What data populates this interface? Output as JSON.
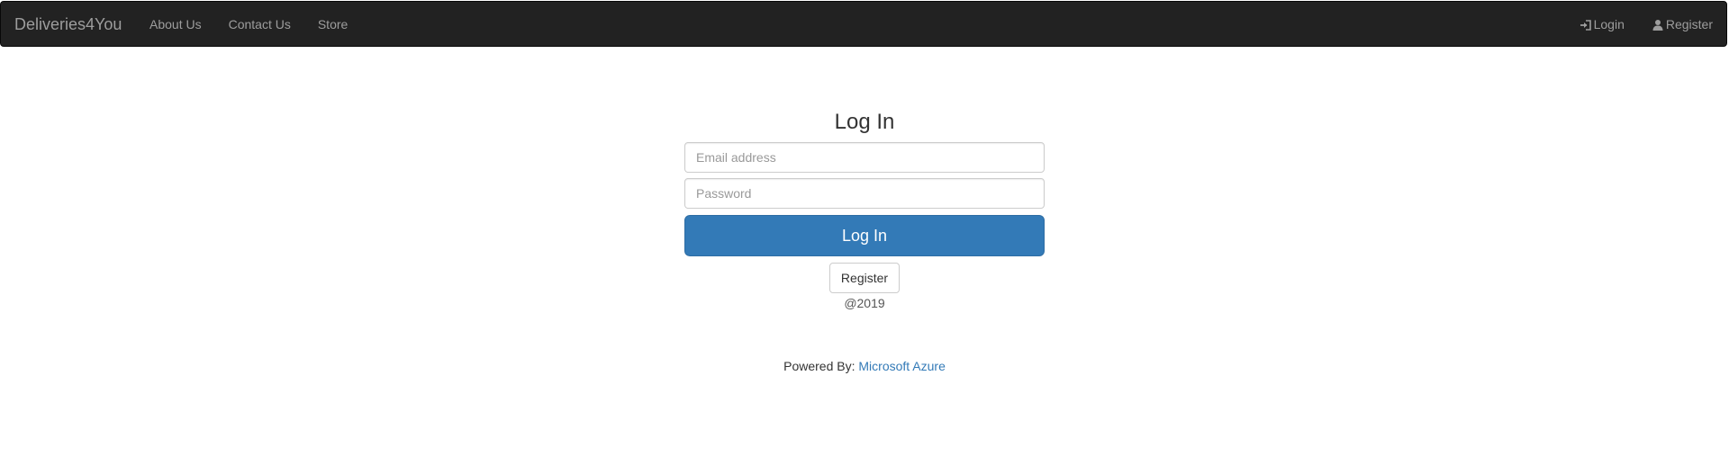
{
  "navbar": {
    "brand": "Deliveries4You",
    "links": [
      {
        "label": "About Us"
      },
      {
        "label": "Contact Us"
      },
      {
        "label": "Store"
      }
    ],
    "right": [
      {
        "label": "Login",
        "icon": "log-in-icon"
      },
      {
        "label": "Register",
        "icon": "user-icon"
      }
    ]
  },
  "login": {
    "title": "Log In",
    "email_placeholder": "Email address",
    "password_placeholder": "Password",
    "submit_label": "Log In",
    "register_label": "Register",
    "copyright": "@2019"
  },
  "footer": {
    "prefix": "Powered By:",
    "link": "Microsoft Azure"
  },
  "colors": {
    "navbar_bg": "#222222",
    "primary": "#337ab7",
    "link": "#337ab7"
  }
}
